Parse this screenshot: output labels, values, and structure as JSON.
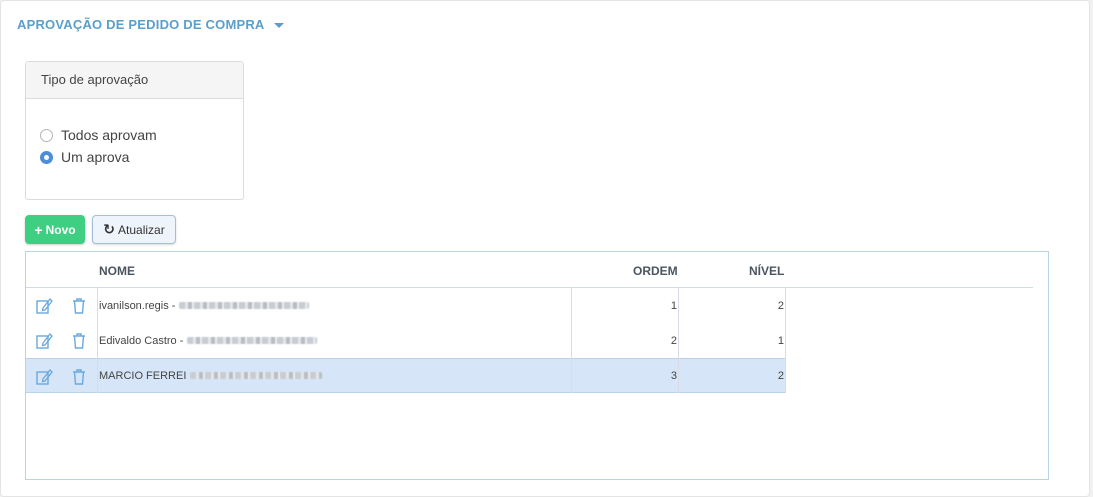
{
  "panel": {
    "title": "APROVAÇÃO DE PEDIDO DE COMPRA"
  },
  "approval": {
    "legend": "Tipo de aprovação",
    "options": [
      {
        "label": "Todos aprovam",
        "checked": false
      },
      {
        "label": "Um aprova",
        "checked": true
      }
    ]
  },
  "toolbar": {
    "new_label": "Novo",
    "refresh_label": "Atualizar"
  },
  "grid": {
    "columns": {
      "nome": "NOME",
      "ordem": "ORDEM",
      "nivel": "NÍVEL"
    },
    "rows": [
      {
        "nome": "ivanilson.regis -",
        "ordem": "1",
        "nivel": "2",
        "selected": false
      },
      {
        "nome": "Edivaldo Castro -",
        "ordem": "2",
        "nivel": "1",
        "selected": false
      },
      {
        "nome": "MARCIO FERREI",
        "ordem": "3",
        "nivel": "2",
        "selected": true
      }
    ]
  },
  "colors": {
    "title": "#5a9fca",
    "accent_green": "#3fcf83",
    "selection": "#d6e6f8",
    "icon": "#6aa8de"
  }
}
